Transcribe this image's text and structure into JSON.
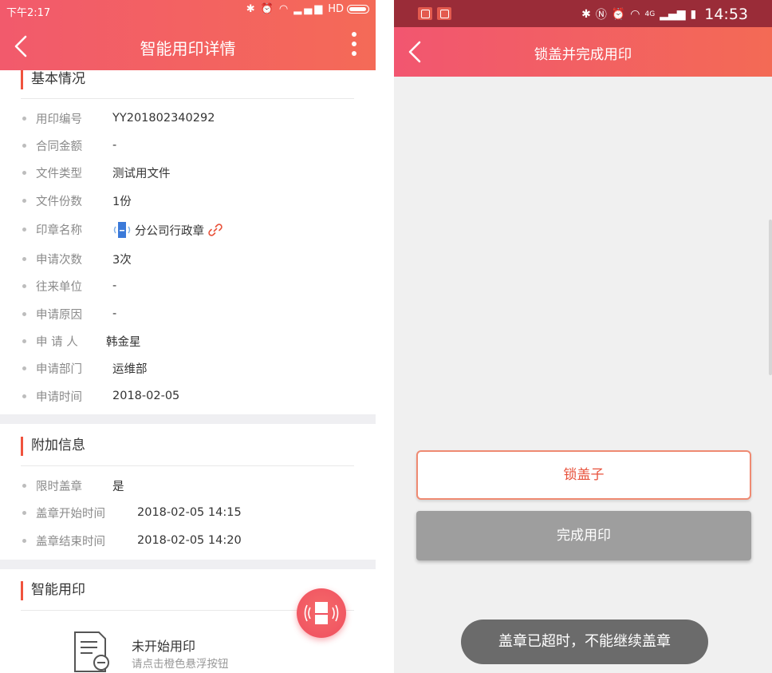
{
  "left": {
    "status": {
      "time": "下午2:17",
      "hd": "HD"
    },
    "appbar": {
      "title": "智能用印详情"
    },
    "basic": {
      "title": "基本情况",
      "rows": [
        {
          "label": "用印编号",
          "value": "YY201802340292"
        },
        {
          "label": "合同金额",
          "value": "-"
        },
        {
          "label": "文件类型",
          "value": "测试用文件"
        },
        {
          "label": "文件份数",
          "value": "1份"
        },
        {
          "label": "印章名称",
          "value": "分公司行政章"
        },
        {
          "label": "申请次数",
          "value": "3次"
        },
        {
          "label": "往来单位",
          "value": "-"
        },
        {
          "label": "申请原因",
          "value": "-"
        },
        {
          "label": "申 请 人",
          "value": "韩金星"
        },
        {
          "label": "申请部门",
          "value": "运维部"
        },
        {
          "label": "申请时间",
          "value": "2018-02-05"
        }
      ]
    },
    "extra": {
      "title": "附加信息",
      "rows": [
        {
          "label": "限时盖章",
          "value": "是"
        },
        {
          "label": "盖章开始时间",
          "value": "2018-02-05 14:15"
        },
        {
          "label": "盖章结束时间",
          "value": "2018-02-05 14:20"
        }
      ]
    },
    "smart": {
      "title": "智能用印",
      "empty_title": "未开始用印",
      "empty_hint": "请点击橙色悬浮按钮"
    }
  },
  "right": {
    "status": {
      "time": "14:53",
      "net": "4G"
    },
    "appbar": {
      "title": "锁盖并完成用印"
    },
    "lock_button": "锁盖子",
    "done_button": "完成用印",
    "toast": "盖章已超时，不能继续盖章"
  },
  "colors": {
    "accent": "#f0533e",
    "appbar_start": "#f25a6c",
    "appbar_end": "#f46a57",
    "disabled": "#9e9e9e"
  }
}
